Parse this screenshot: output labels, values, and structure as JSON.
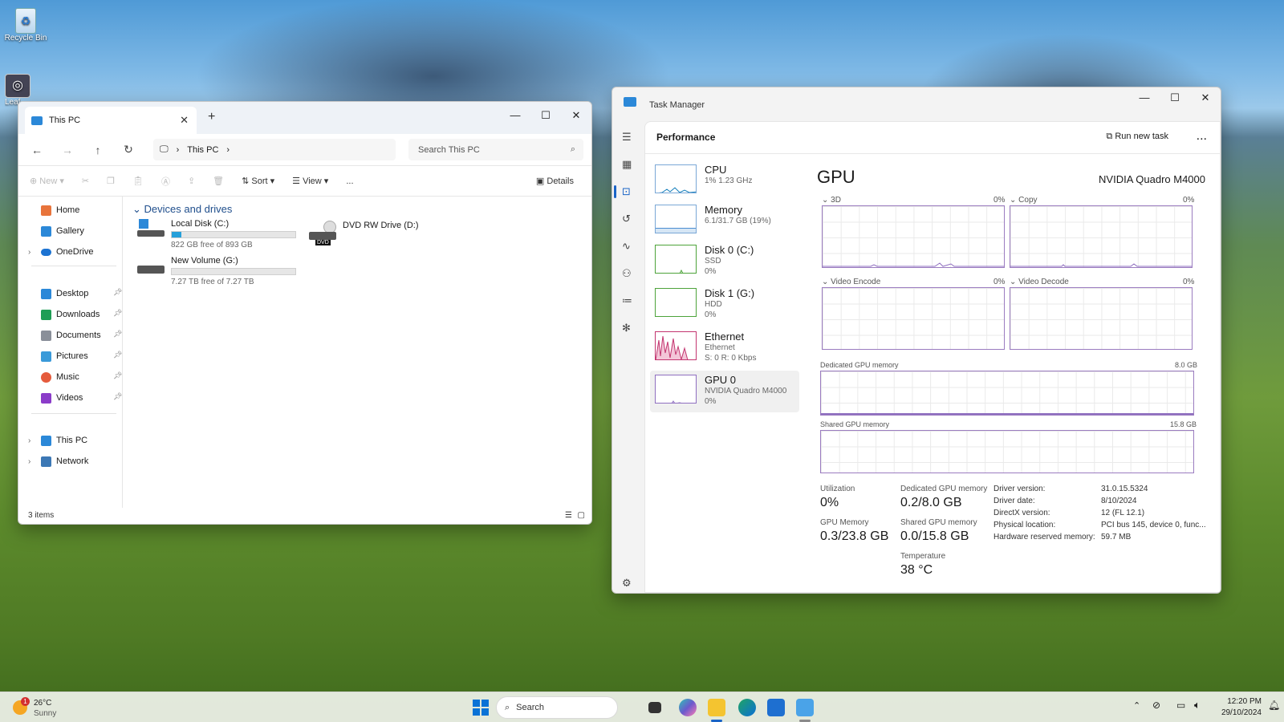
{
  "desktop": {
    "icons": [
      {
        "label": "Recycle Bin"
      },
      {
        "label": "Leaf this"
      }
    ]
  },
  "explorer": {
    "tab_title": "This PC",
    "address": [
      "This PC"
    ],
    "search_placeholder": "Search This PC",
    "toolbar": {
      "new": "New",
      "sort": "Sort",
      "view": "View",
      "more": "...",
      "details": "Details"
    },
    "nav": {
      "top": [
        {
          "label": "Home"
        },
        {
          "label": "Gallery"
        },
        {
          "label": "OneDrive"
        }
      ],
      "pinned": [
        {
          "label": "Desktop"
        },
        {
          "label": "Downloads"
        },
        {
          "label": "Documents"
        },
        {
          "label": "Pictures"
        },
        {
          "label": "Music"
        },
        {
          "label": "Videos"
        }
      ],
      "bottom": [
        {
          "label": "This PC"
        },
        {
          "label": "Network"
        }
      ]
    },
    "group_label": "Devices and drives",
    "drives": [
      {
        "name": "Local Disk (C:)",
        "free": "822 GB free of 893 GB",
        "used_fraction": 0.08
      },
      {
        "name": "DVD RW Drive (D:)",
        "badge": "DVD"
      },
      {
        "name": "New Volume (G:)",
        "free": "7.27 TB free of 7.27 TB",
        "used_fraction": 0.0
      }
    ],
    "status": "3 items"
  },
  "taskmgr": {
    "title": "Task Manager",
    "section": "Performance",
    "run_new_task": "Run new task",
    "more": "...",
    "resources": [
      {
        "name": "CPU",
        "line1": "1% 1.23 GHz",
        "line2": ""
      },
      {
        "name": "Memory",
        "line1": "6.1/31.7 GB (19%)",
        "line2": ""
      },
      {
        "name": "Disk 0 (C:)",
        "line1": "SSD",
        "line2": "0%"
      },
      {
        "name": "Disk 1 (G:)",
        "line1": "HDD",
        "line2": "0%"
      },
      {
        "name": "Ethernet",
        "line1": "Ethernet",
        "line2": "S: 0 R: 0 Kbps"
      },
      {
        "name": "GPU 0",
        "line1": "NVIDIA Quadro M4000",
        "line2": "0%"
      }
    ],
    "gpu": {
      "title": "GPU",
      "model": "NVIDIA Quadro M4000",
      "engines": [
        {
          "name": "3D",
          "pct": "0%"
        },
        {
          "name": "Copy",
          "pct": "0%"
        },
        {
          "name": "Video Encode",
          "pct": "0%"
        },
        {
          "name": "Video Decode",
          "pct": "0%"
        }
      ],
      "dedicated_label": "Dedicated GPU memory",
      "dedicated_max": "8.0 GB",
      "shared_label": "Shared GPU memory",
      "shared_max": "15.8 GB",
      "stats": [
        {
          "label": "Utilization",
          "value": "0%"
        },
        {
          "label": "Dedicated GPU memory",
          "value": "0.2/8.0 GB"
        },
        {
          "label": "GPU Memory",
          "value": "0.3/23.8 GB"
        },
        {
          "label": "Shared GPU memory",
          "value": "0.0/15.8 GB"
        },
        {
          "label": "Temperature",
          "value": "38 °C"
        }
      ],
      "details": [
        {
          "k": "Driver version:",
          "v": "31.0.15.5324"
        },
        {
          "k": "Driver date:",
          "v": "8/10/2024"
        },
        {
          "k": "DirectX version:",
          "v": "12 (FL 12.1)"
        },
        {
          "k": "Physical location:",
          "v": "PCI bus 145, device 0, func..."
        },
        {
          "k": "Hardware reserved memory:",
          "v": "59.7 MB"
        }
      ]
    }
  },
  "taskbar": {
    "weather_temp": "26°C",
    "weather_desc": "Sunny",
    "weather_badge": "1",
    "search": "Search",
    "time": "12:20 PM",
    "date": "29/10/2024"
  }
}
